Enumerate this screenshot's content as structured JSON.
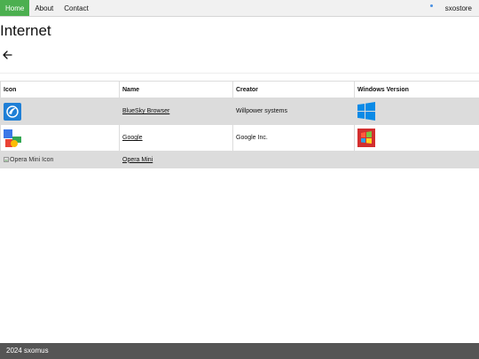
{
  "nav": {
    "items": [
      "Home",
      "About",
      "Contact"
    ],
    "store_label": "sxostore",
    "active_color": "#4CAF50"
  },
  "page": {
    "title": "Internet"
  },
  "table": {
    "headers": [
      "Icon",
      "Name",
      "Creator",
      "Windows Version"
    ],
    "rows": [
      {
        "icon": "bluesky-browser-icon",
        "name": "BlueSky Browser",
        "creator": "Willpower systems",
        "windows_icon": "windows-modern-logo-icon"
      },
      {
        "icon": "google-icon",
        "name": "Google",
        "creator": "Google Inc.",
        "windows_icon": "windows-classic-logo-icon"
      },
      {
        "icon_alt": "Opera Mini Icon",
        "name": "Opera Mini",
        "creator": "",
        "windows_icon": ""
      }
    ]
  },
  "footer": {
    "text": "2024 sxomus"
  }
}
